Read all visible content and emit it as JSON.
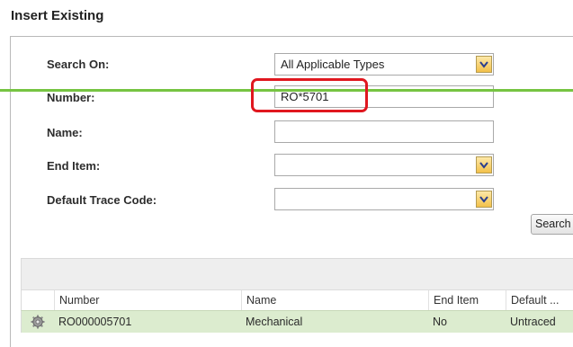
{
  "dialog": {
    "title": "Insert Existing"
  },
  "form": {
    "search_on": {
      "label": "Search On:",
      "value": "All Applicable Types"
    },
    "number": {
      "label": "Number:",
      "value": "RO*5701"
    },
    "name": {
      "label": "Name:",
      "value": ""
    },
    "end_item": {
      "label": "End Item:",
      "value": ""
    },
    "default_trace_code": {
      "label": "Default Trace Code:",
      "value": ""
    },
    "search_button": "Search"
  },
  "results": {
    "columns": [
      "Number",
      "Name",
      "End Item",
      "Default ..."
    ],
    "rows": [
      {
        "icon": "gear-icon",
        "number": "RO000005701",
        "name": "Mechanical",
        "end_item": "No",
        "default": "Untraced"
      }
    ]
  },
  "colors": {
    "highlight": "#e0171f",
    "annotation_line": "#76c442",
    "selected_row": "#dceccf"
  }
}
